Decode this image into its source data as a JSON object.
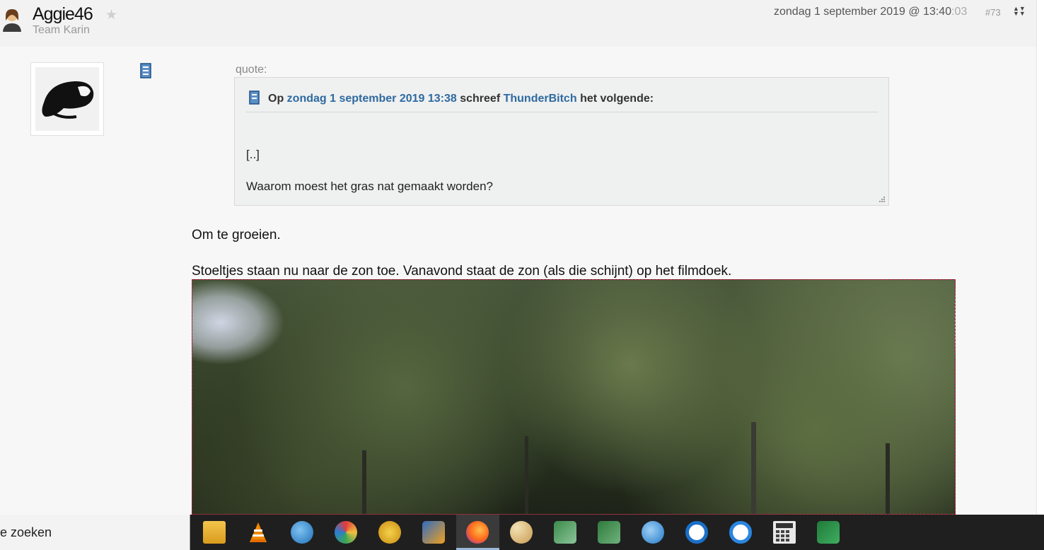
{
  "post": {
    "username": "Aggie46",
    "team": "Team Karin",
    "date": "zondag 1 september 2019 @ 13:40",
    "date_seconds": ":03",
    "number": "#73"
  },
  "quote": {
    "label": "quote:",
    "prefix": "Op",
    "date_link": "zondag 1 september 2019 13:38",
    "middle": "schreef",
    "author_link": "ThunderBitch",
    "suffix": "het volgende:",
    "line1": "[..]",
    "line2": "Waarom moest het gras nat gemaakt worden?"
  },
  "body": {
    "p1": "Om te groeien.",
    "p2": "Stoeltjes staan nu naar de zon toe. Vanavond staat de zon (als die schijnt) op het filmdoek."
  },
  "taskbar": {
    "search_text": "e zoeken",
    "apps": [
      "file-explorer-icon",
      "vlc-icon",
      "thunderbird-icon",
      "photoscape-icon",
      "davinci-icon",
      "paint-shop-icon",
      "firefox-icon",
      "paint-icon",
      "excel-red-icon",
      "excel-green-icon",
      "mail-icon",
      "app-blue-icon",
      "app-g-icon",
      "calculator-icon",
      "excel-icon"
    ]
  }
}
